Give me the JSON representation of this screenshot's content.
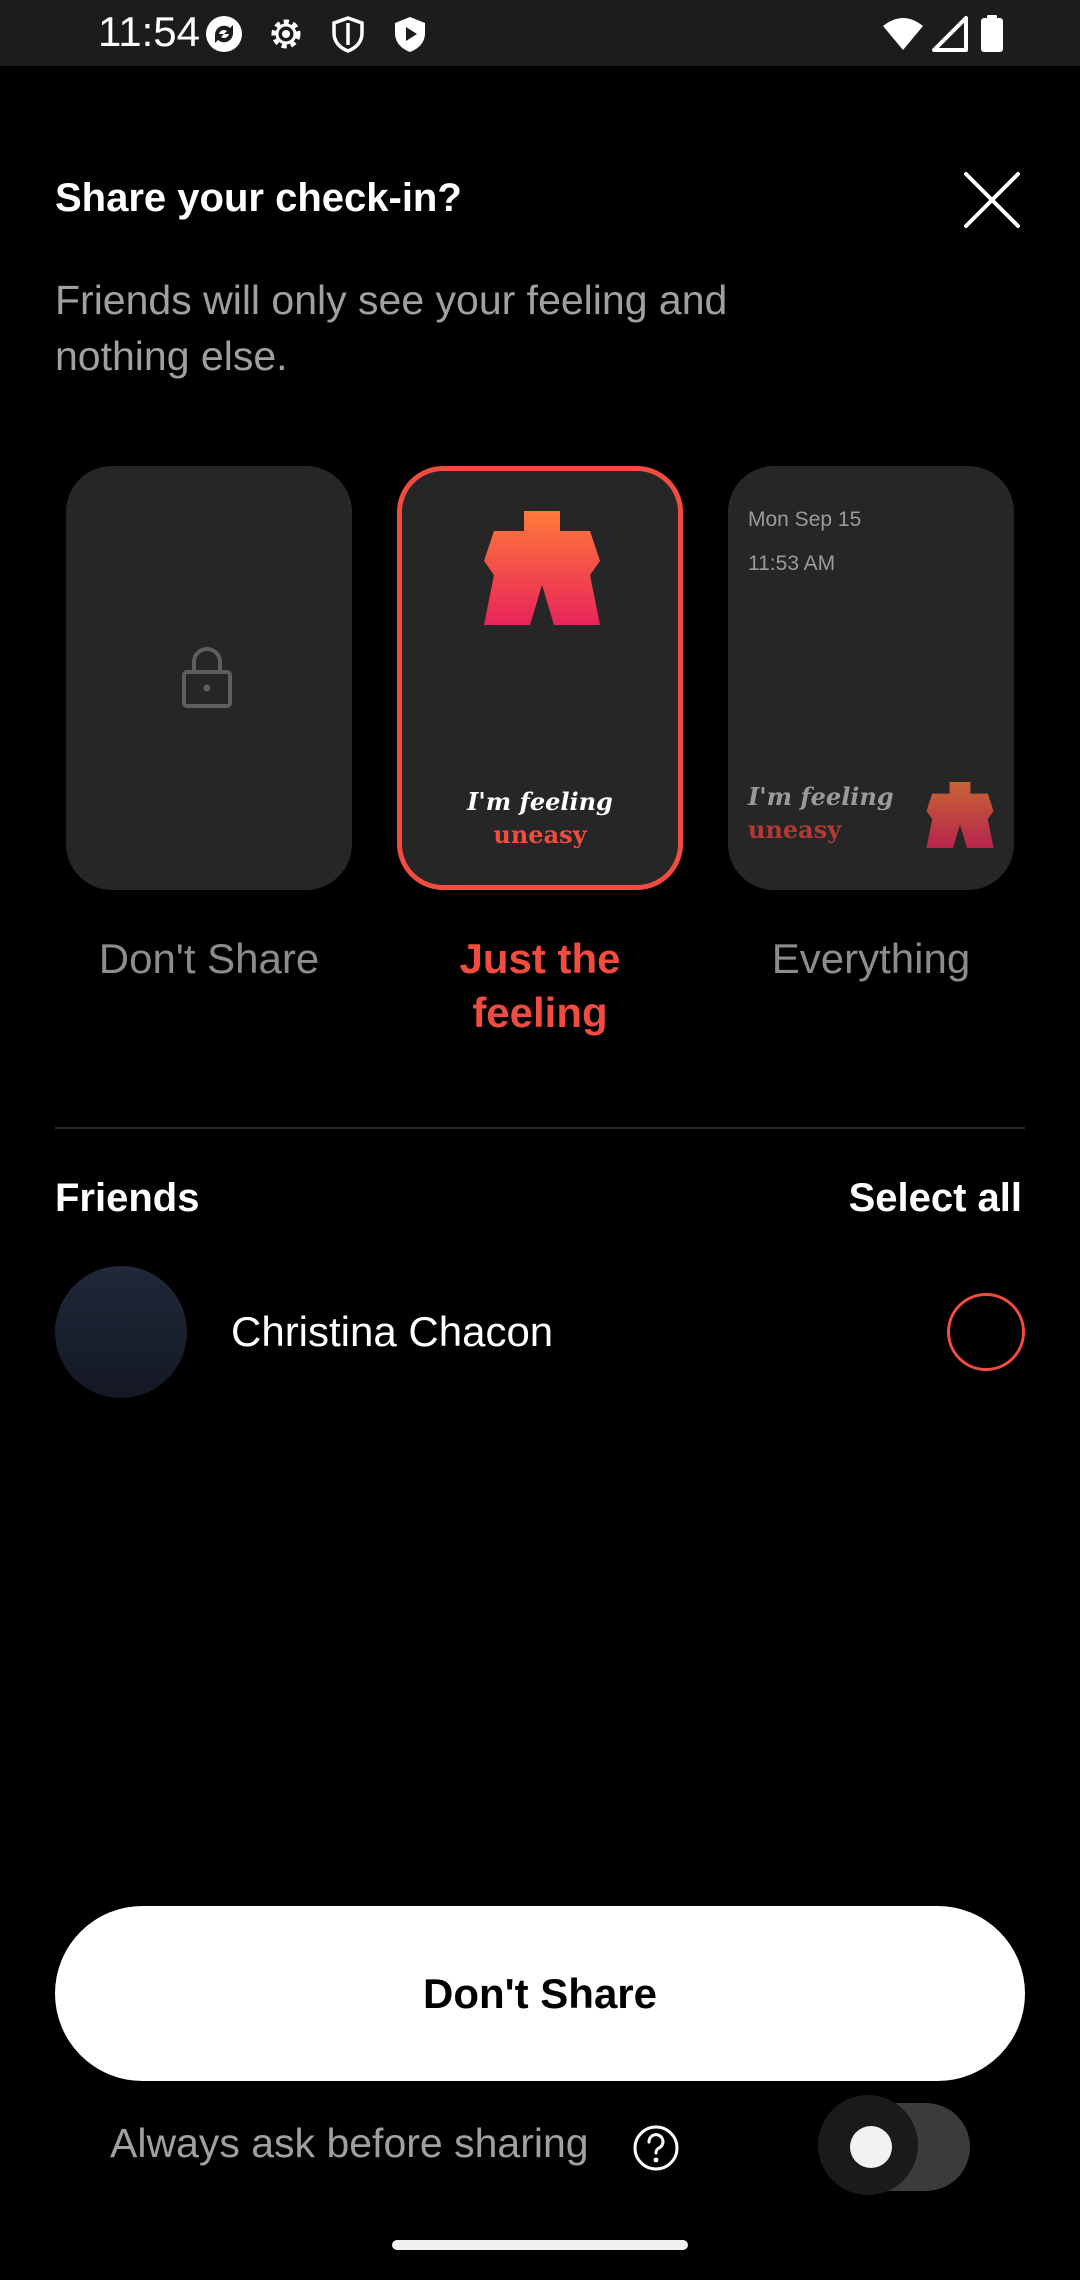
{
  "status_bar": {
    "time": "11:54",
    "left_icons": [
      "sync-icon",
      "gear-icon",
      "shield-icon",
      "play-shield-icon"
    ],
    "right_icons": [
      "wifi-icon",
      "signal-icon",
      "battery-icon"
    ]
  },
  "header": {
    "title": "Share your check-in?",
    "subtitle": "Friends will only see your feeling and nothing else."
  },
  "options": [
    {
      "label": "Don't Share",
      "selected": false
    },
    {
      "label_line1": "Just the",
      "label_line2": "feeling",
      "selected": true,
      "feeling_prefix": "I'm feeling",
      "feeling": "uneasy"
    },
    {
      "label": "Everything",
      "selected": false,
      "date": "Mon Sep 15",
      "time": "11:53 AM",
      "feeling_prefix": "I'm feeling",
      "feeling": "uneasy"
    }
  ],
  "friends": {
    "heading": "Friends",
    "select_all": "Select all",
    "list": [
      {
        "name": "Christina Chacon",
        "selected": false
      }
    ]
  },
  "footer": {
    "primary_button": "Don't Share",
    "always_ask_label": "Always ask before sharing",
    "always_ask_enabled": false
  },
  "colors": {
    "accent": "#f24b3f",
    "card_bg": "#262626",
    "muted_text": "#8c8c8c",
    "gradient_top": "#ff7a3a",
    "gradient_bottom": "#e8245a"
  }
}
